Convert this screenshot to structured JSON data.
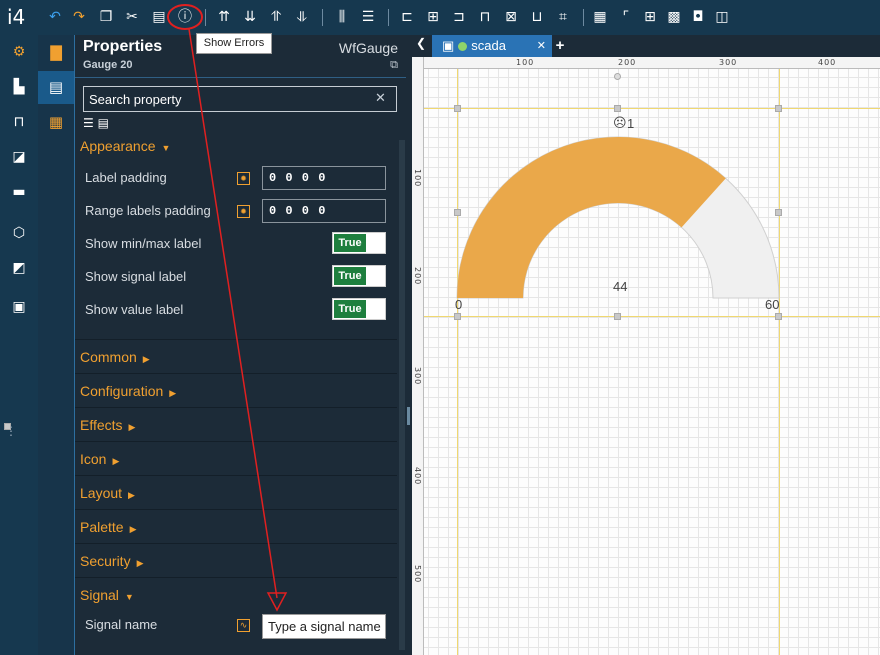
{
  "app": {
    "logo": "i4"
  },
  "tooltip": {
    "show_errors": "Show Errors"
  },
  "panel": {
    "title": "Properties",
    "subtitle": "Gauge 20",
    "type": "WfGauge",
    "search_placeholder": "Search property",
    "appearance": "Appearance",
    "rows": {
      "label_padding": "Label padding",
      "label_padding_value": "0 0 0 0",
      "range_labels_padding": "Range labels padding",
      "range_labels_padding_value": "0 0 0 0",
      "show_minmax": "Show min/max label",
      "show_signal": "Show signal label",
      "show_value": "Show value label",
      "toggle_true": "True"
    },
    "sections": {
      "common": "Common",
      "configuration": "Configuration",
      "effects": "Effects",
      "icon": "Icon",
      "layout": "Layout",
      "palette": "Palette",
      "security": "Security",
      "signal": "Signal"
    },
    "signal_name_label": "Signal name",
    "signal_name_placeholder": "Type a signal name"
  },
  "designer": {
    "tab_name": "scada",
    "ruler_h": [
      "100",
      "200",
      "300",
      "400"
    ],
    "ruler_v": [
      "100",
      "200",
      "300",
      "400",
      "500"
    ],
    "gauge": {
      "min": "0",
      "max": "60",
      "value_label": "44",
      "signal_count": "1",
      "value": 44,
      "min_value": 0,
      "max_value": 60,
      "fill_color": "#eaa84a",
      "track_color": "#f0f0f0"
    }
  },
  "colors": {
    "accent": "#f0a030",
    "topbar": "#16384f",
    "annotation": "#e02020"
  }
}
